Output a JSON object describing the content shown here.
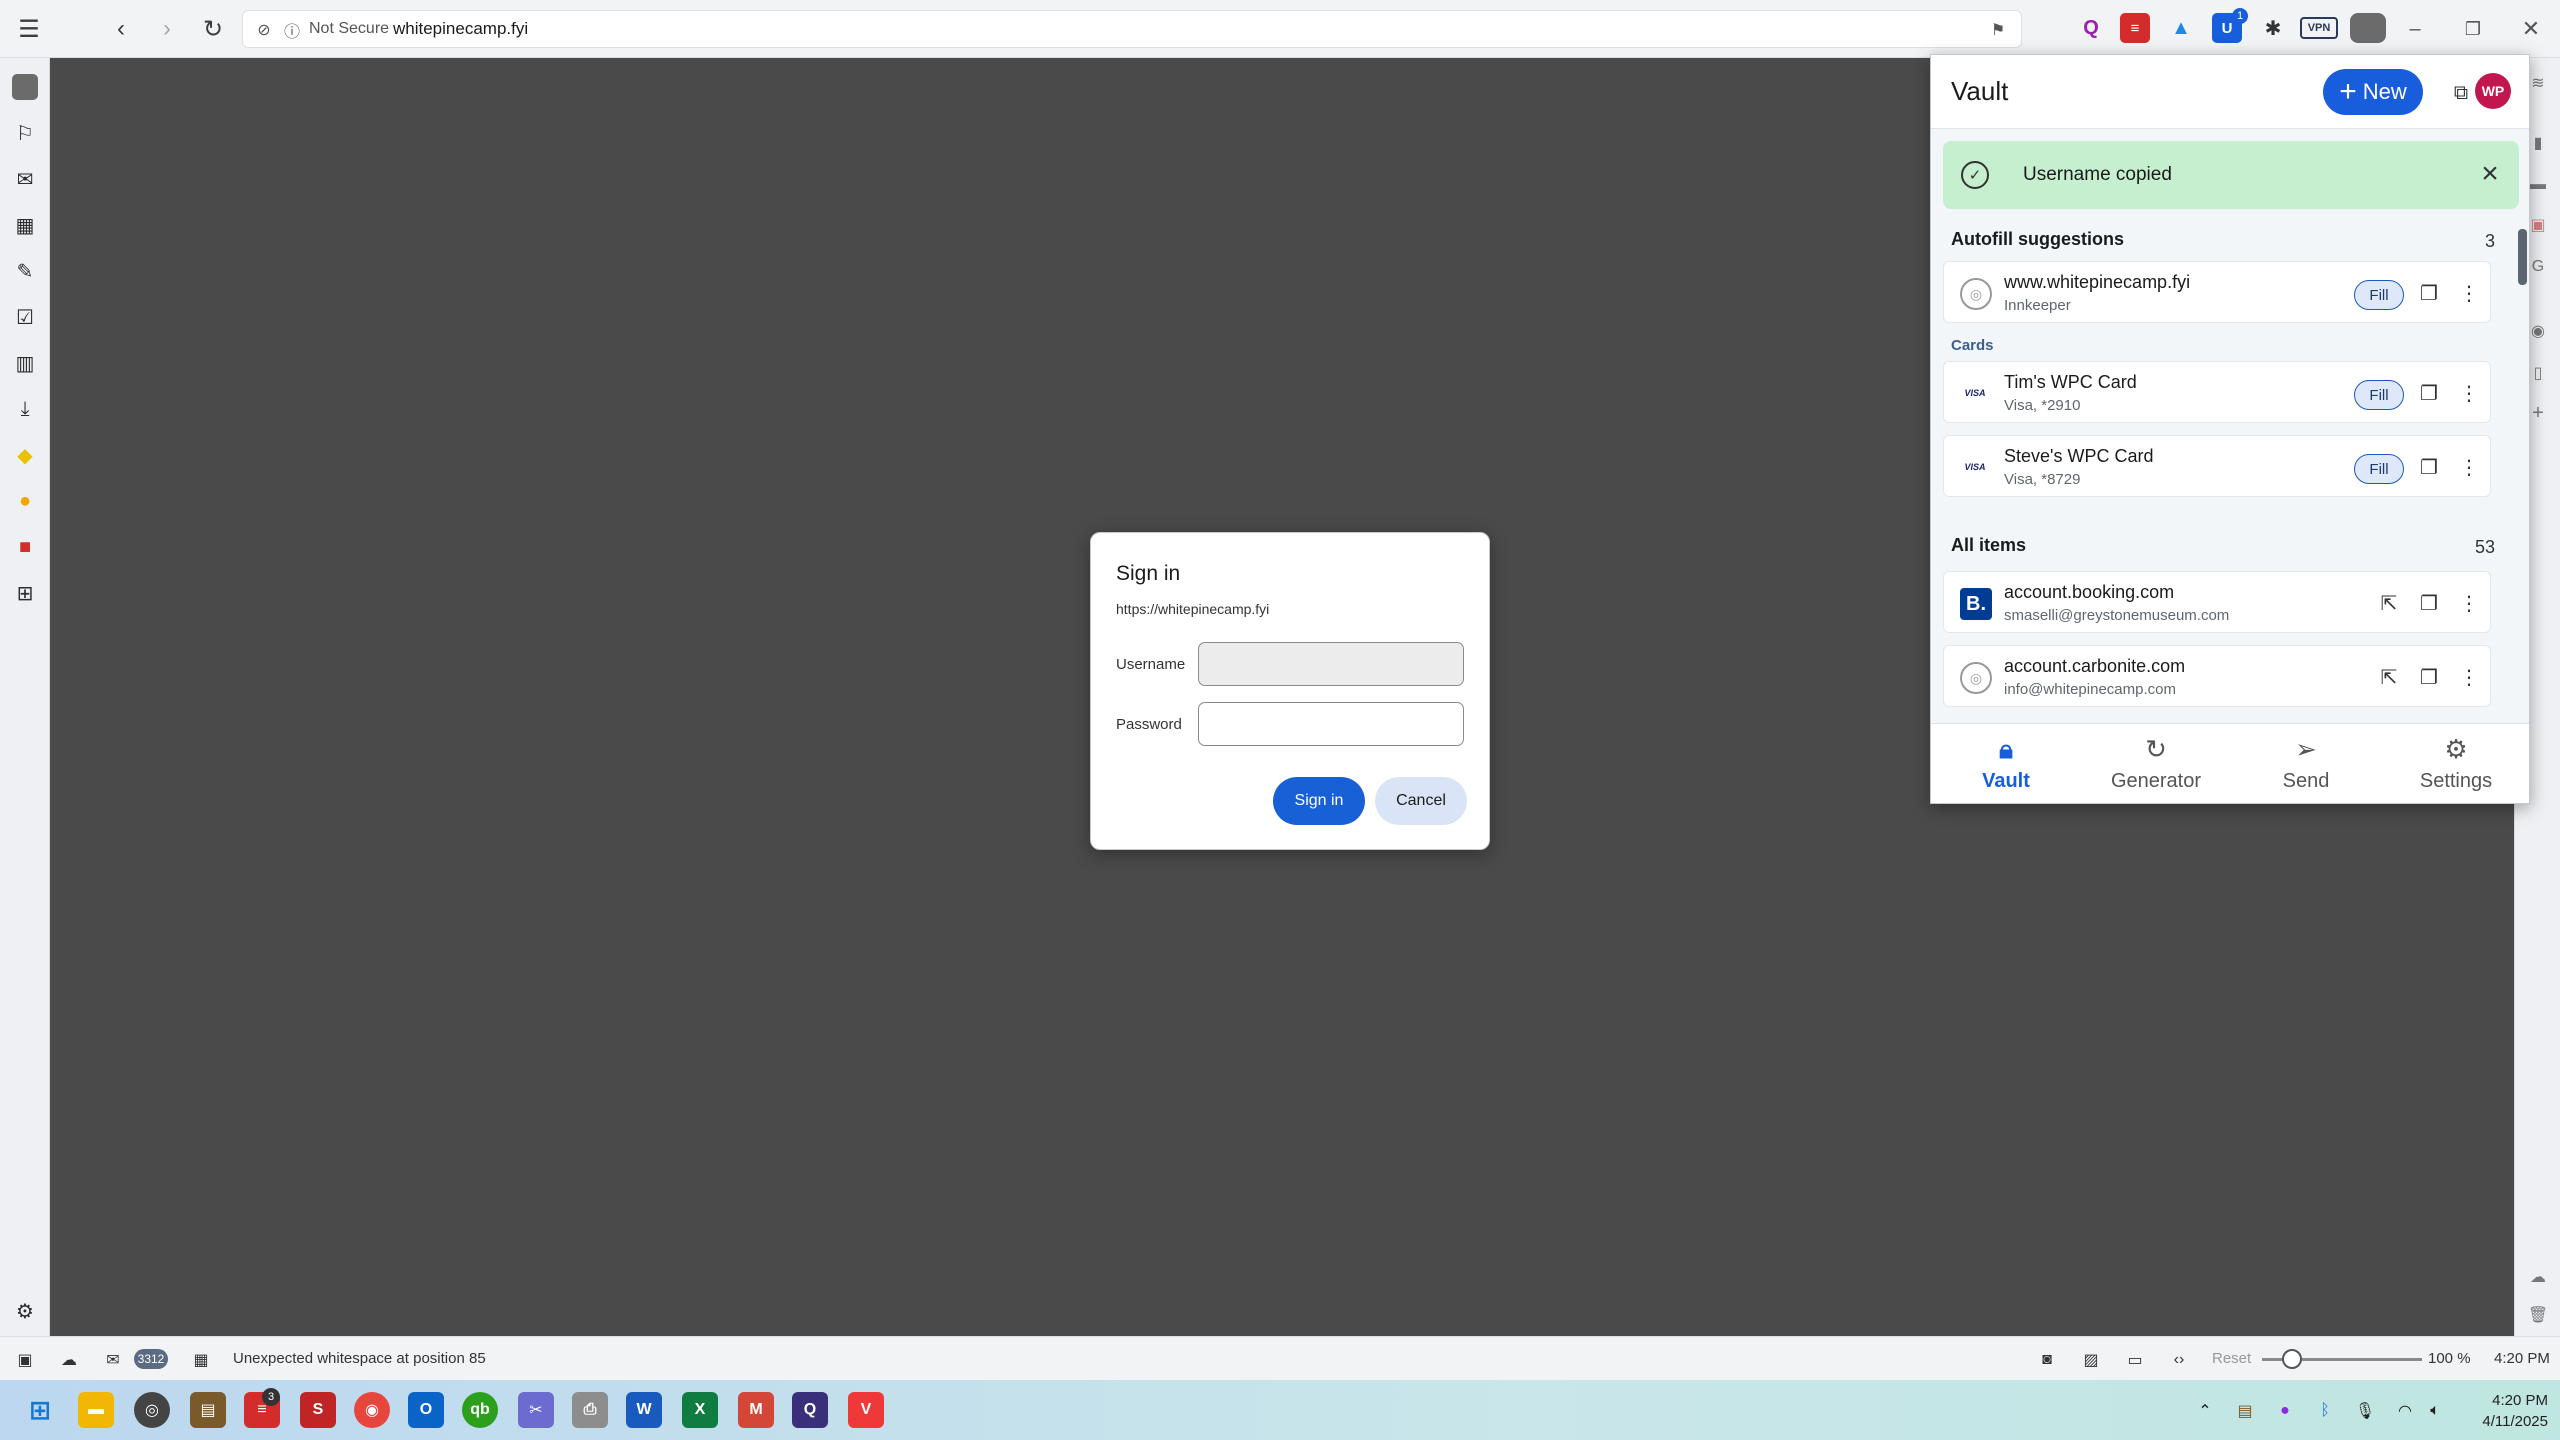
{
  "browser": {
    "security_label": "Not Secure",
    "url": "whitepinecamp.fyi",
    "extension_badge": "1",
    "vpn_label": "VPN"
  },
  "dialog": {
    "title": "Sign in",
    "origin": "https://whitepinecamp.fyi",
    "username_label": "Username",
    "username_value": "",
    "password_label": "Password",
    "password_value": "",
    "sign_in_label": "Sign in",
    "cancel_label": "Cancel"
  },
  "vault": {
    "title": "Vault",
    "new_label": "New",
    "avatar_initials": "WP",
    "toast": "Username copied",
    "autofill_title": "Autofill suggestions",
    "autofill_count": "3",
    "cards_title": "Cards",
    "all_items_title": "All items",
    "all_items_count": "53",
    "fill_label": "Fill",
    "autofill": [
      {
        "name": "www.whitepinecamp.fyi",
        "sub": "Innkeeper"
      }
    ],
    "cards": [
      {
        "name": "Tim's WPC Card",
        "sub": "Visa, *2910",
        "brand": "VISA"
      },
      {
        "name": "Steve's WPC Card",
        "sub": "Visa, *8729",
        "brand": "VISA"
      }
    ],
    "items": [
      {
        "name": "account.booking.com",
        "sub": "smaselli@greystonemuseum.com",
        "logo": "B."
      },
      {
        "name": "account.carbonite.com",
        "sub": "info@whitepinecamp.com",
        "logo": ""
      }
    ],
    "tabs": [
      {
        "label": "Vault",
        "icon": "lock-icon"
      },
      {
        "label": "Generator",
        "icon": "refresh-icon"
      },
      {
        "label": "Send",
        "icon": "send-icon"
      },
      {
        "label": "Settings",
        "icon": "gear-icon"
      }
    ],
    "accent": "#175ddc"
  },
  "statusbar": {
    "mail_count": "3312",
    "message": "Unexpected whitespace at position 85",
    "reset_label": "Reset",
    "zoom": "100 %",
    "time": "4:20 PM"
  },
  "taskbar": {
    "badge": "3",
    "time": "4:20 PM",
    "date": "4/11/2025"
  }
}
